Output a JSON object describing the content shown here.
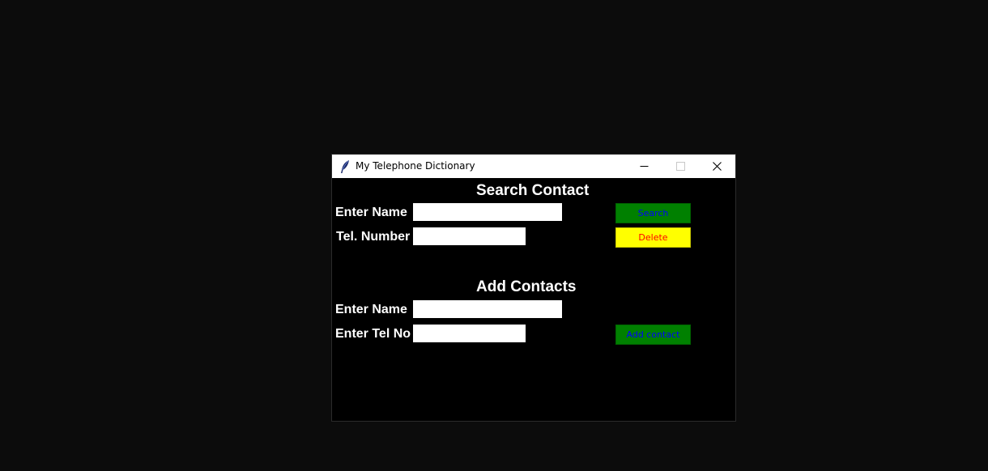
{
  "window": {
    "title": "My Telephone Dictionary",
    "icon": "feather-icon"
  },
  "search_section": {
    "heading": "Search Contact",
    "name_label": "Enter Name",
    "name_value": "",
    "number_label": "Tel. Number",
    "number_value": "",
    "search_button": "Search",
    "delete_button": "Delete"
  },
  "add_section": {
    "heading": "Add Contacts",
    "name_label": "Enter Name",
    "name_value": "",
    "tel_label": "Enter Tel No",
    "tel_value": "",
    "add_button": "Add contact"
  },
  "colors": {
    "screen_background": "#0c0c0c",
    "window_background": "#000000",
    "label_text": "#ffffff",
    "search_button_bg": "#008000",
    "search_button_text": "#0000ff",
    "delete_button_bg": "#ffff00",
    "delete_button_text": "#ff0000",
    "add_button_bg": "#008000",
    "add_button_text": "#0000ff"
  }
}
